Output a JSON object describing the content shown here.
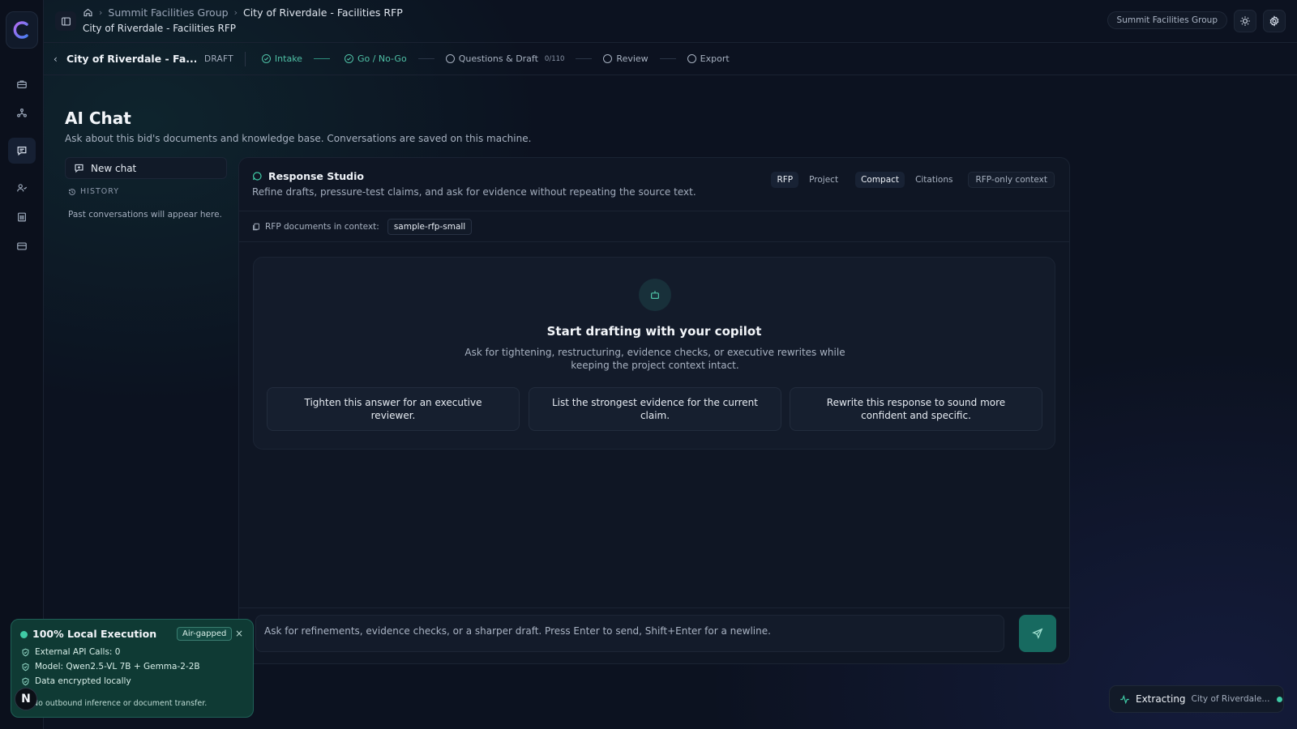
{
  "app": {
    "accent": "#3fcaa5"
  },
  "rail": {
    "items": [
      {
        "name": "briefcase-icon"
      },
      {
        "name": "network-icon"
      },
      {
        "name": "chat-icon",
        "active": true
      },
      {
        "name": "users-icon"
      },
      {
        "name": "building-icon"
      },
      {
        "name": "card-icon"
      }
    ]
  },
  "header": {
    "breadcrumb": [
      "Summit Facilities Group",
      "City of Riverdale - Facilities RFP"
    ],
    "subtitle": "City of Riverdale - Facilities RFP",
    "org_chip": "Summit Facilities Group"
  },
  "workflow": {
    "bid_title": "City of Riverdale - Fa...",
    "status": "DRAFT",
    "steps": [
      {
        "label": "Intake",
        "state": "done"
      },
      {
        "label": "Go / No-Go",
        "state": "done"
      },
      {
        "label": "Questions & Draft",
        "count": "0/110",
        "state": "pending"
      },
      {
        "label": "Review",
        "state": "pending"
      },
      {
        "label": "Export",
        "state": "pending"
      }
    ]
  },
  "page": {
    "title": "AI Chat",
    "description": "Ask about this bid's documents and knowledge base. Conversations are saved on this machine."
  },
  "chat_sidebar": {
    "new_chat": "New chat",
    "history_heading": "HISTORY",
    "history_empty": "Past conversations will appear here."
  },
  "studio": {
    "title": "Response Studio",
    "description": "Refine drafts, pressure-test claims, and ask for evidence without repeating the source text.",
    "tabs": [
      "RFP",
      "Project",
      "Compact",
      "Citations",
      "RFP-only context"
    ],
    "context_label": "RFP documents in context:",
    "context_doc": "sample-rfp-small",
    "empty_title": "Start drafting with your copilot",
    "empty_description": "Ask for tightening, restructuring, evidence checks, or executive rewrites while keeping the project context intact.",
    "suggestions": [
      "Tighten this answer for an executive reviewer.",
      "List the strongest evidence for the current claim.",
      "Rewrite this response to sound more confident and specific."
    ],
    "composer_placeholder": "Ask for refinements, evidence checks, or a sharper draft. Press Enter to send, Shift+Enter for a newline."
  },
  "local_card": {
    "title": "100% Local Execution",
    "badge": "Air-gapped",
    "close": "×",
    "lines": [
      "External API Calls: 0",
      "Model: Qwen2.5-VL 7B + Gemma-2-2B",
      "Data encrypted locally"
    ],
    "footer": "No outbound inference or document transfer.",
    "avatar_letter": "N"
  },
  "toast": {
    "label": "Extracting",
    "target": "City of Riverdale..."
  }
}
